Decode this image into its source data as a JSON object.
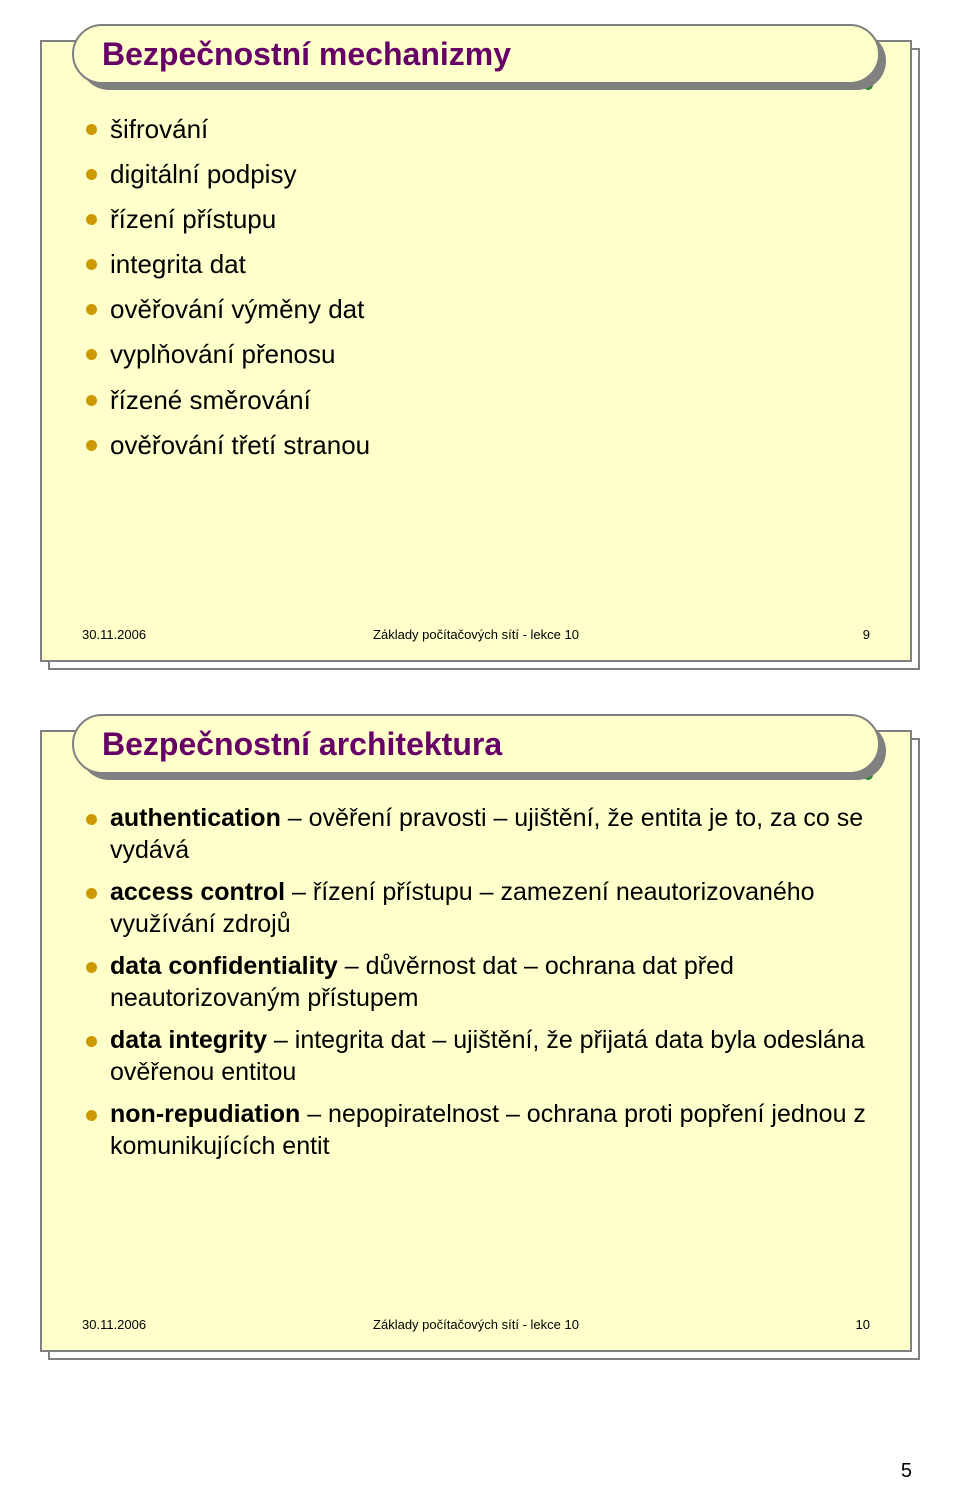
{
  "page_number": "5",
  "dot_colors": [
    "#8a2be2",
    "#ff8c00",
    "#cc9900",
    "#228b22",
    "#8b4513",
    "#8a2be2",
    "#ff4500",
    "#4682b4",
    "#228b22"
  ],
  "slide1": {
    "title": "Bezpečnostní mechanizmy",
    "items": [
      "šifrování",
      "digitální podpisy",
      "řízení přístupu",
      "integrita dat",
      "ověřování výměny dat",
      "vyplňování přenosu",
      "řízené směrování",
      "ověřování třetí stranou"
    ],
    "footer_date": "30.11.2006",
    "footer_center": "Základy počítačových sítí - lekce 10",
    "footer_num": "9"
  },
  "slide2": {
    "title": "Bezpečnostní architektura",
    "items": [
      {
        "bold": "authentication",
        "rest": " – ověření pravosti – ujištění, že entita je to, za co se vydává"
      },
      {
        "bold": "access control",
        "rest": " – řízení přístupu – zamezení neautorizovaného využívání zdrojů"
      },
      {
        "bold": "data confidentiality",
        "rest": " – důvěrnost dat – ochrana dat před neautorizovaným přístupem"
      },
      {
        "bold": "data integrity",
        "rest": " – integrita dat – ujištění, že přijatá data byla odeslána ověřenou entitou"
      },
      {
        "bold": "non-repudiation",
        "rest": " – nepopiratelnost – ochrana proti popření jednou z komunikujících entit"
      }
    ],
    "footer_date": "30.11.2006",
    "footer_center": "Základy počítačových sítí - lekce 10",
    "footer_num": "10"
  }
}
